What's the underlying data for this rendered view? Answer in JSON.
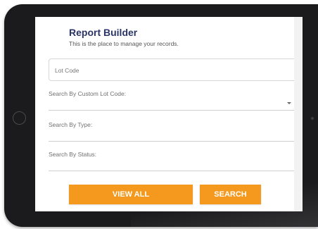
{
  "header": {
    "title": "Report Builder",
    "subtitle": "This is the place to manage your records."
  },
  "form": {
    "lot_code": {
      "placeholder": "Lot Code",
      "value": ""
    },
    "custom_lot_code": {
      "label": "Search By Custom Lot Code:"
    },
    "type": {
      "label": "Search By Type:"
    },
    "status": {
      "label": "Search By Status:"
    }
  },
  "actions": {
    "view_all_label": "VIEW ALL",
    "search_label": "SEARCH"
  },
  "colors": {
    "accent": "#f4981e",
    "title": "#2a3566",
    "device_frame": "#1b1b1d"
  },
  "icons": {
    "dropdown": "chevron-down-icon",
    "home_button": "home-button-icon",
    "camera": "camera-icon"
  }
}
